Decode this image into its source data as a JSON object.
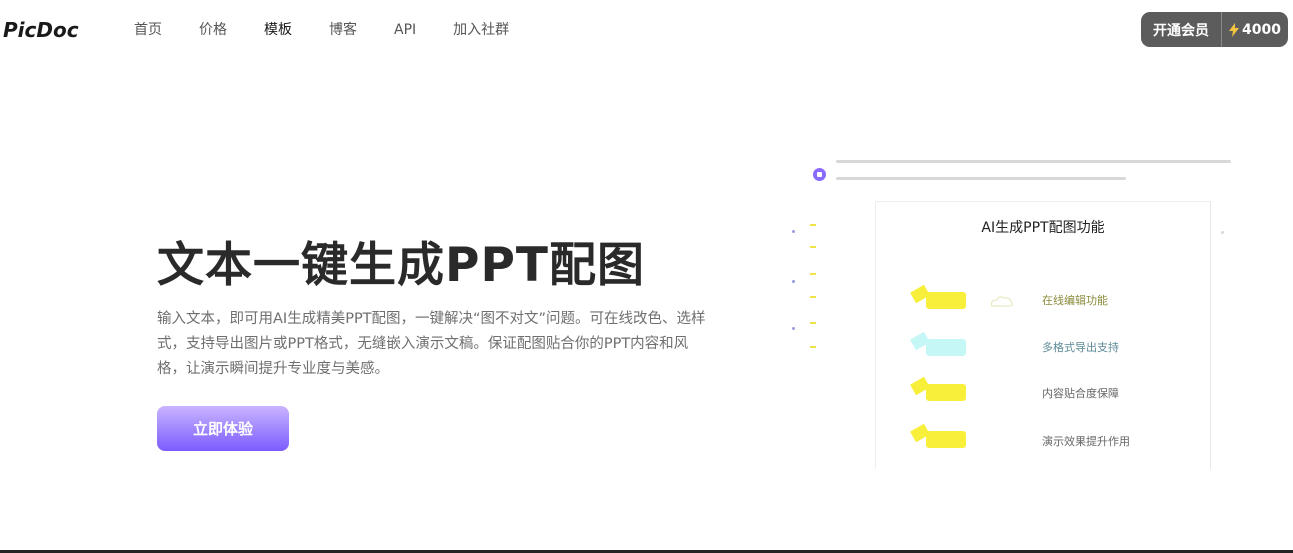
{
  "brand": {
    "name": "PicDoc"
  },
  "nav": {
    "items": [
      {
        "label": "首页"
      },
      {
        "label": "价格"
      },
      {
        "label": "模板"
      },
      {
        "label": "博客"
      },
      {
        "label": "API"
      },
      {
        "label": "加入社群"
      }
    ],
    "active_index": 2
  },
  "member": {
    "label": "开通会员",
    "credits": "4000",
    "credits_icon": "lightning-bolt-icon"
  },
  "hero": {
    "title": "文本一键生成PPT配图",
    "description": "输入文本，即可用AI生成精美PPT配图，一键解决“图不对文”问题。可在线改色、选样式，支持导出图片或PPT格式，无缝嵌入演示文稿。保证配图贴合你的PPT内容和风格，让演示瞬间提升专业度与美感。",
    "cta_label": "立即体验"
  },
  "preview": {
    "card_title": "AI生成PPT配图功能",
    "features": [
      {
        "label": "在线编辑功能",
        "highlight_color": "#f7ef3a",
        "text_color": "#8a8a3a"
      },
      {
        "label": "多格式导出支持",
        "highlight_color": "#c6f7f7",
        "text_color": "#5a8a96"
      },
      {
        "label": "内容贴合度保障",
        "highlight_color": "#f7ef3a",
        "text_color": "#666666"
      },
      {
        "label": "演示效果提升作用",
        "highlight_color": "#f7ef3a",
        "text_color": "#666666"
      }
    ]
  },
  "colors": {
    "accent": "#7c5cff",
    "member_bg": "#5c5c5c",
    "title": "#2a2a2a"
  }
}
